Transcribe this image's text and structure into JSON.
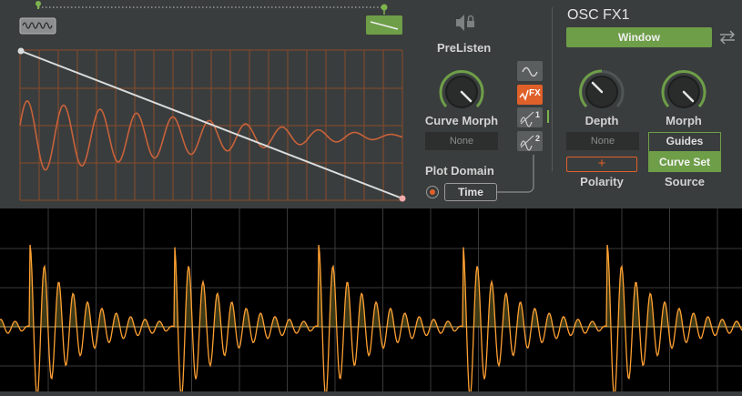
{
  "curve_editor": {
    "wave_thumb_icon": "sine-wave-thumbnail-icon",
    "ramp_thumb_icon": "ramp-down-thumbnail-icon",
    "curve": {
      "start": 1.0,
      "end": 0.0
    }
  },
  "prelisten": {
    "icon": "speaker-lock-icon",
    "label": "PreListen"
  },
  "curve_morph": {
    "label": "Curve Morph",
    "value_text": "None"
  },
  "plot_domain": {
    "label": "Plot Domain",
    "value": "Time"
  },
  "fx_buttons": [
    {
      "name": "sine-icon"
    },
    {
      "name": "fx-icon",
      "label": "FX",
      "active": true
    },
    {
      "name": "morph-1-icon",
      "label": "1"
    },
    {
      "name": "morph-2-icon",
      "label": "2"
    }
  ],
  "osc_fx": {
    "title": "OSC FX1",
    "mode_button": "Window",
    "swap_icon": "swap-arrows-icon",
    "depth": {
      "label": "Depth",
      "value_text": "None"
    },
    "morph": {
      "label": "Morph"
    },
    "polarity": {
      "label": "Polarity",
      "value": "+"
    },
    "source": {
      "label": "Source",
      "options": [
        "Guides",
        "Curve Set"
      ],
      "selected": "Curve Set"
    }
  },
  "colors": {
    "accent_green": "#6e9e48",
    "accent_orange": "#e0602a",
    "waveform": "#ffa032",
    "panel_bg": "#3a3d3d"
  }
}
